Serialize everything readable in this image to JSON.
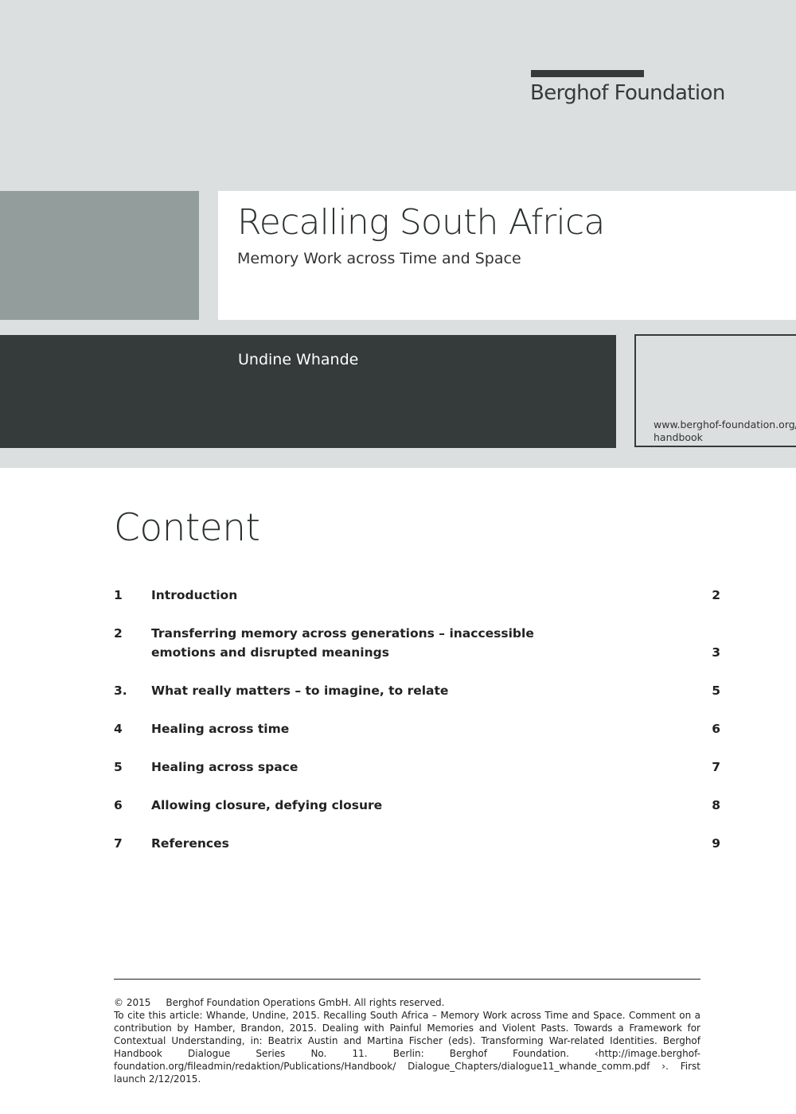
{
  "header": {
    "logo_text": "Berghof Foundation"
  },
  "cover": {
    "title": "Recalling South Africa",
    "subtitle": "Memory Work across Time and Space",
    "author": "Undine Whande",
    "url_line1": "www.berghof-foundation.org/",
    "url_line2": "handbook"
  },
  "contents": {
    "heading": "Content",
    "items": [
      {
        "num": "1",
        "title": "Introduction",
        "page": "2"
      },
      {
        "num": "2",
        "title": "Transferring memory across generations – inaccessible emotions and disrupted meanings",
        "page": "3"
      },
      {
        "num": "3.",
        "title": "What really matters – to imagine, to relate",
        "page": "5"
      },
      {
        "num": "4",
        "title": "Healing across time",
        "page": "6"
      },
      {
        "num": "5",
        "title": "Healing across space",
        "page": "7"
      },
      {
        "num": "6",
        "title": "Allowing closure, defying closure",
        "page": "8"
      },
      {
        "num": "7",
        "title": "References",
        "page": "9"
      }
    ]
  },
  "footer": {
    "copyright": "© 2015     Berghof Foundation Operations GmbH. All rights reserved.",
    "citation": "To cite this article: Whande, Undine, 2015. Recalling South Africa – Memory Work across Time and Space.  Comment on a contribution by Hamber, Brandon, 2015. Dealing with Painful Memories and Violent Pasts. Towards a Framework for Contextual Understanding, in: Beatrix Austin and Martina Fischer (eds). Transforming War-related Identities. Berghof Handbook Dialogue Series No. 11. Berlin: Berghof Foundation. ‹http://image.berghof-foundation.org/fileadmin/redaktion/Publications/Handbook/ Dialogue_Chapters/dialogue11_whande_comm.pdf ›. First launch 2/12/2015."
  }
}
